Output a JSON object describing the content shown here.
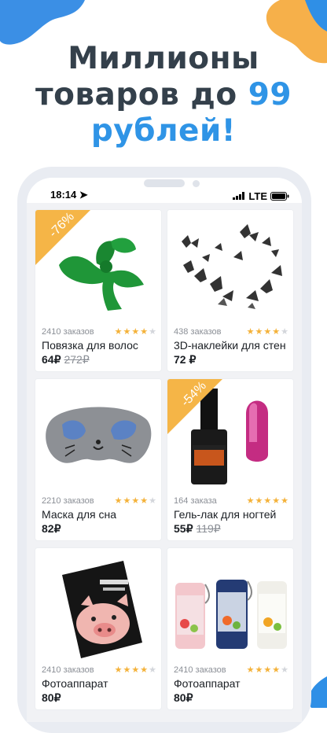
{
  "headline": {
    "line1": "Миллионы",
    "line2_prefix": "товаров до ",
    "line2_accent": "99",
    "line3_accent": "рублей!"
  },
  "status_bar": {
    "time": "18:14",
    "network": "LTE"
  },
  "products": [
    {
      "discount": "-76%",
      "orders": "2410 заказов",
      "rating": 4,
      "title": "Повязка для волос",
      "price": "64₽",
      "old_price": "272₽"
    },
    {
      "discount": "",
      "orders": "438 заказов",
      "rating": 4,
      "title": "3D-наклейки для стен",
      "price": "72 ₽",
      "old_price": ""
    },
    {
      "discount": "",
      "orders": "2210 заказов",
      "rating": 4,
      "title": "Маска для сна",
      "price": "82₽",
      "old_price": ""
    },
    {
      "discount": "-54%",
      "orders": "164 заказа",
      "rating": 5,
      "title": "Гель-лак для ногтей",
      "price": "55₽",
      "old_price": "119₽"
    },
    {
      "discount": "",
      "orders": "2410 заказов",
      "rating": 4,
      "title": "Фотоаппарат",
      "price": "80₽",
      "old_price": ""
    },
    {
      "discount": "",
      "orders": "2410 заказов",
      "rating": 4,
      "title": "Фотоаппарат",
      "price": "80₽",
      "old_price": ""
    }
  ],
  "colors": {
    "accent_blue": "#2f94e6",
    "discount_orange": "#f5b547",
    "star": "#f4b23a",
    "headline": "#34404b"
  }
}
